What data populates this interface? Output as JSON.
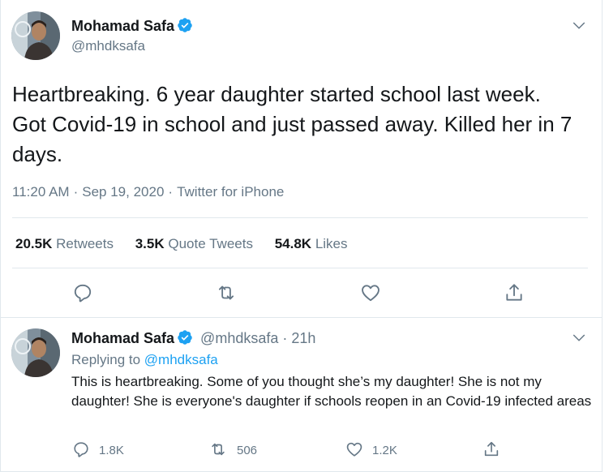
{
  "tweet": {
    "author_name": "Mohamad Safa",
    "author_handle": "@mhdksafa",
    "text": "Heartbreaking. 6 year daughter started school last week. Got Covid-19 in school and just passed away. Killed her in 7 days.",
    "time": "11:20 AM",
    "date": "Sep 19, 2020",
    "source": "Twitter for iPhone",
    "separator": "·",
    "stats": {
      "retweets_count": "20.5K",
      "retweets_label": "Retweets",
      "quotes_count": "3.5K",
      "quotes_label": "Quote Tweets",
      "likes_count": "54.8K",
      "likes_label": "Likes"
    }
  },
  "reply": {
    "author_name": "Mohamad Safa",
    "author_handle": "@mhdksafa",
    "separator": "·",
    "age": "21h",
    "replying_prefix": "Replying to",
    "replying_to": "@mhdksafa",
    "text": "This is heartbreaking. Some of you thought she’s my daughter! She is not my daughter! She is everyone's daughter if schools reopen in an Covid-19 infected areas",
    "counts": {
      "replies": "1.8K",
      "retweets": "506",
      "likes": "1.2K"
    }
  },
  "icons": {
    "verified": "verified-badge-icon",
    "more": "chevron-down-icon",
    "reply": "reply-icon",
    "retweet": "retweet-icon",
    "like": "heart-icon",
    "share": "share-icon"
  },
  "colors": {
    "accent": "#1da1f2",
    "secondary_text": "#657786",
    "primary_text": "#14171a",
    "border": "#e1e8ed"
  }
}
